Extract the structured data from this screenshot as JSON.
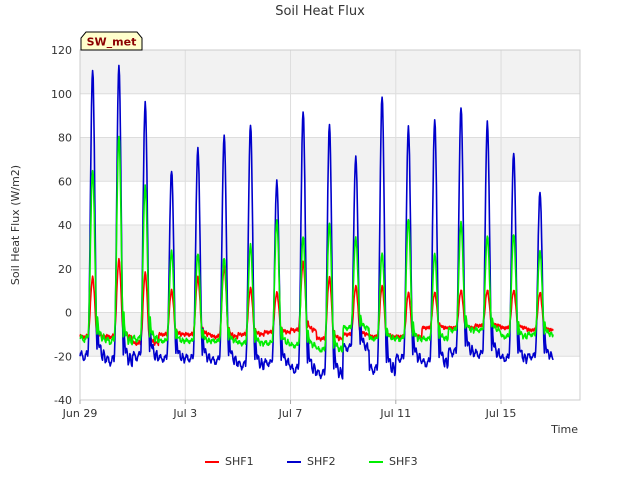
{
  "chart_data": {
    "type": "line",
    "title": "Soil Heat Flux",
    "xlabel": "Time",
    "ylabel": "Soil Heat Flux (W/m2)",
    "station_label": "SW_met",
    "ylim": [
      -40,
      120
    ],
    "yticks": [
      -40,
      -20,
      0,
      20,
      40,
      60,
      80,
      100,
      120
    ],
    "xlim": [
      "2024-06-29",
      "2024-07-18"
    ],
    "xticks": [
      {
        "date": "2024-06-29",
        "label": "Jun 29"
      },
      {
        "date": "2024-07-03",
        "label": "Jul 3"
      },
      {
        "date": "2024-07-07",
        "label": "Jul 7"
      },
      {
        "date": "2024-07-11",
        "label": "Jul 11"
      },
      {
        "date": "2024-07-15",
        "label": "Jul 15"
      }
    ],
    "grid": true,
    "legend_position": "bottom-center",
    "series": [
      {
        "name": "SHF1",
        "color": "#ff0000",
        "days": [
          "2024-06-29",
          "2024-06-30",
          "2024-07-01",
          "2024-07-02",
          "2024-07-03",
          "2024-07-04",
          "2024-07-05",
          "2024-07-06",
          "2024-07-07",
          "2024-07-08",
          "2024-07-09",
          "2024-07-10",
          "2024-07-11",
          "2024-07-12",
          "2024-07-13",
          "2024-07-14",
          "2024-07-15",
          "2024-07-16"
        ],
        "daily_min": [
          -11,
          -11,
          -14,
          -10,
          -10,
          -11,
          -10,
          -9,
          -8,
          -12,
          -10,
          -11,
          -11,
          -7,
          -7,
          -6,
          -7,
          -8
        ],
        "daily_max": [
          16,
          24,
          18,
          10,
          16,
          21,
          11,
          9,
          23,
          16,
          12,
          12,
          9,
          9,
          10,
          10,
          10,
          9
        ]
      },
      {
        "name": "SHF2",
        "color": "#0000cc",
        "days": [
          "2024-06-29",
          "2024-06-30",
          "2024-07-01",
          "2024-07-02",
          "2024-07-03",
          "2024-07-04",
          "2024-07-05",
          "2024-07-06",
          "2024-07-07",
          "2024-07-08",
          "2024-07-09",
          "2024-07-10",
          "2024-07-11",
          "2024-07-12",
          "2024-07-13",
          "2024-07-14",
          "2024-07-15",
          "2024-07-16"
        ],
        "daily_min": [
          -20,
          -22,
          -20,
          -21,
          -21,
          -22,
          -24,
          -23,
          -26,
          -28,
          -16,
          -26,
          -21,
          -23,
          -18,
          -19,
          -21,
          -20
        ],
        "daily_max": [
          111,
          113,
          96,
          65,
          75,
          81,
          86,
          60,
          92,
          86,
          71,
          99,
          85,
          88,
          94,
          87,
          73,
          55
        ]
      },
      {
        "name": "SHF3",
        "color": "#00ee00",
        "days": [
          "2024-06-29",
          "2024-06-30",
          "2024-07-01",
          "2024-07-02",
          "2024-07-03",
          "2024-07-04",
          "2024-07-05",
          "2024-07-06",
          "2024-07-07",
          "2024-07-08",
          "2024-07-09",
          "2024-07-10",
          "2024-07-11",
          "2024-07-12",
          "2024-07-13",
          "2024-07-14",
          "2024-07-15",
          "2024-07-16"
        ],
        "daily_min": [
          -12,
          -13,
          -12,
          -13,
          -13,
          -13,
          -14,
          -14,
          -15,
          -17,
          -7,
          -12,
          -12,
          -12,
          -8,
          -8,
          -11,
          -10
        ],
        "daily_max": [
          65,
          81,
          58,
          28,
          27,
          25,
          31,
          42,
          35,
          41,
          34,
          27,
          43,
          27,
          41,
          35,
          36,
          28
        ]
      }
    ]
  }
}
